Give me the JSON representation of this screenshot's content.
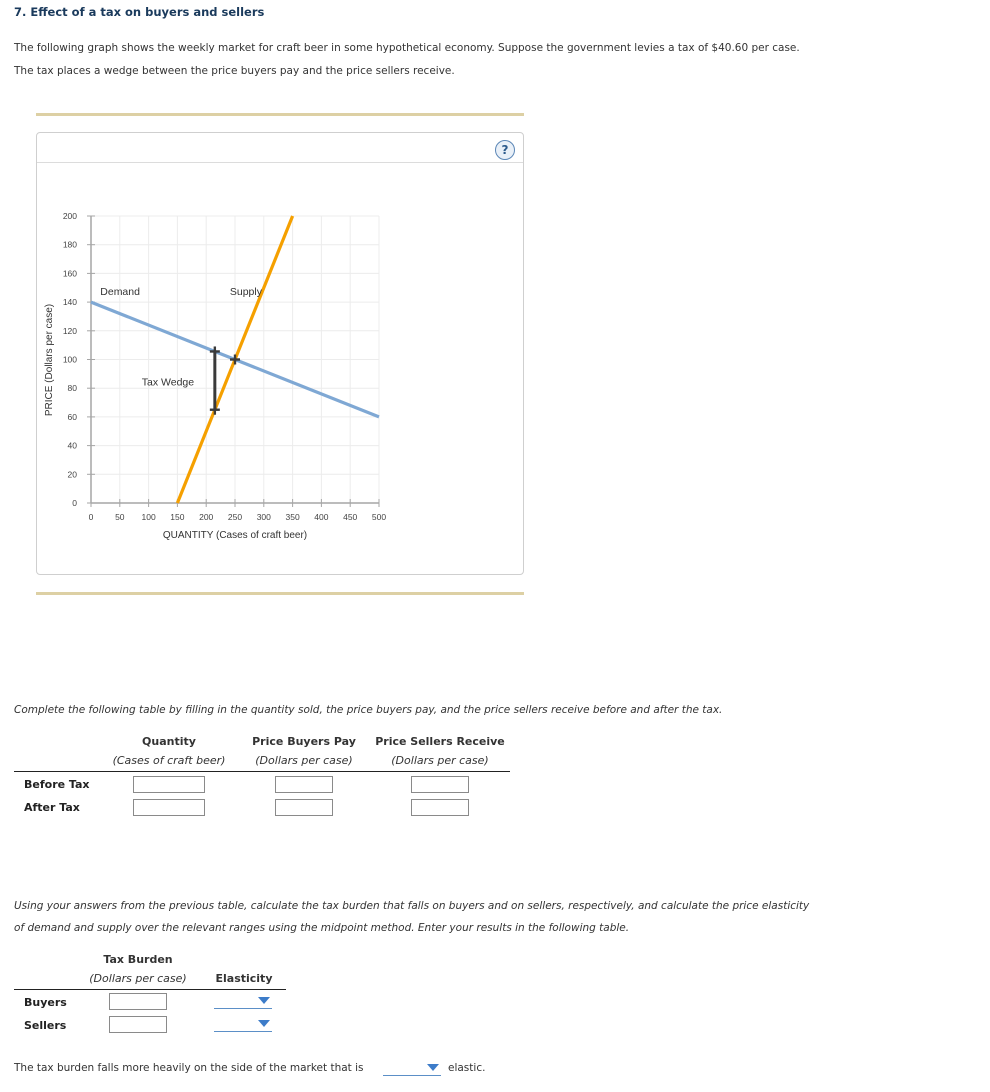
{
  "header": {
    "title": "7. Effect of a tax on buyers and sellers",
    "intro_line1": "The following graph shows the weekly market for craft beer in some hypothetical economy. Suppose the government levies a tax of $40.60 per case.",
    "intro_line2": "The tax places a wedge between the price buyers pay and the price sellers receive."
  },
  "graph": {
    "help_icon": "?",
    "colors": {
      "demand": "#7fa8d4",
      "supply": "#f5a000",
      "wedge": "#3a3a3a",
      "grid": "#ececec",
      "axis": "#a6a6a6",
      "tan_bar": "#ddd0a4"
    }
  },
  "chart_data": {
    "type": "line",
    "title": "",
    "xlabel": "QUANTITY (Cases of craft beer)",
    "ylabel": "PRICE (Dollars per case)",
    "xlim": [
      0,
      500
    ],
    "ylim": [
      0,
      200
    ],
    "xticks": [
      0,
      50,
      100,
      150,
      200,
      250,
      300,
      350,
      400,
      450,
      500
    ],
    "yticks": [
      0,
      20,
      40,
      60,
      80,
      100,
      120,
      140,
      160,
      180,
      200
    ],
    "grid": true,
    "series": [
      {
        "name": "Demand",
        "label": "Demand",
        "points": [
          [
            0,
            140
          ],
          [
            500,
            60
          ]
        ]
      },
      {
        "name": "Supply",
        "label": "Supply",
        "points": [
          [
            150,
            0
          ],
          [
            350,
            200
          ]
        ]
      }
    ],
    "markers": [
      {
        "name": "equilibrium",
        "x": 250,
        "y": 100
      },
      {
        "name": "wedge-top",
        "x": 215,
        "y": 105.6
      },
      {
        "name": "wedge-bottom",
        "x": 215,
        "y": 65
      }
    ],
    "annotations": [
      {
        "text": "Demand",
        "x": 30,
        "y": 145
      },
      {
        "text": "Supply",
        "x": 255,
        "y": 145
      },
      {
        "text": "Tax Wedge",
        "x": 102,
        "y": 82
      }
    ],
    "tax_wedge": {
      "label": "Tax Wedge",
      "quantity": 215,
      "top": 105.6,
      "bottom": 65,
      "tax": 40.6
    }
  },
  "table1": {
    "instruction": "Complete the following table by filling in the quantity sold, the price buyers pay, and the price sellers receive before and after the tax.",
    "columns": [
      {
        "header": "Quantity",
        "sub": "(Cases of craft beer)"
      },
      {
        "header": "Price Buyers Pay",
        "sub": "(Dollars per case)"
      },
      {
        "header": "Price Sellers Receive",
        "sub": "(Dollars per case)"
      }
    ],
    "rows": [
      {
        "label": "Before Tax",
        "values": [
          "",
          "",
          ""
        ]
      },
      {
        "label": "After Tax",
        "values": [
          "",
          "",
          ""
        ]
      }
    ]
  },
  "table2": {
    "instruction_line1": "Using your answers from the previous table, calculate the tax burden that falls on buyers and on sellers, respectively, and calculate the price elasticity",
    "instruction_line2": "of demand and supply over the relevant ranges using the midpoint method. Enter your results in the following table.",
    "columns": [
      {
        "header": "Tax Burden",
        "sub": "(Dollars per case)"
      },
      {
        "header": "Elasticity",
        "sub": ""
      }
    ],
    "rows": [
      {
        "label": "Buyers",
        "tax_burden": "",
        "elasticity": ""
      },
      {
        "label": "Sellers",
        "tax_burden": "",
        "elasticity": ""
      }
    ]
  },
  "final": {
    "prefix": "The tax burden falls more heavily on the side of the market that is",
    "selected": "",
    "suffix": "elastic."
  }
}
